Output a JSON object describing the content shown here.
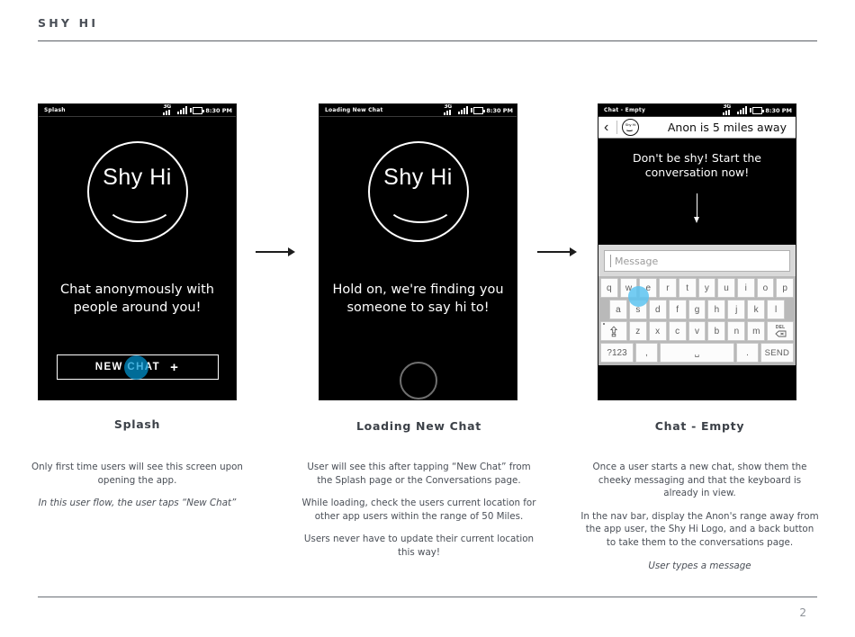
{
  "header": {
    "title": "SHY HI"
  },
  "footer": {
    "page_number": "2"
  },
  "status_bar": {
    "time": "8:30 PM",
    "network": "3G",
    "icons": [
      "3g-icon",
      "signal-bars-icon",
      "battery-icon"
    ]
  },
  "screens": [
    {
      "id": "splash",
      "status_label": "Splash",
      "logo_text": "Shy Hi",
      "headline": "Chat anonymously with people around you!",
      "button_label": "NEW CHAT",
      "button_plus": "+",
      "tap_indicator": "blue-tap-dot"
    },
    {
      "id": "loading-new-chat",
      "status_label": "Loading New Chat",
      "logo_text": "Shy Hi",
      "headline": "Hold on, we're finding you someone to say hi to!",
      "spinner": "loading-spinner"
    },
    {
      "id": "chat-empty",
      "status_label": "Chat - Empty",
      "nav": {
        "back_glyph": "‹",
        "logo_text": "Shy Hi",
        "title": "Anon is 5 miles away"
      },
      "cta": "Don't be shy! Start the conversation now!",
      "arrow": "down-arrow",
      "input": {
        "placeholder": "Message",
        "value": ""
      },
      "keyboard": {
        "row1": [
          "q",
          "w",
          "e",
          "r",
          "t",
          "y",
          "u",
          "i",
          "o",
          "p"
        ],
        "row2": [
          "a",
          "s",
          "d",
          "f",
          "g",
          "h",
          "j",
          "k",
          "l"
        ],
        "row3_shift": "shift",
        "row3": [
          "z",
          "x",
          "c",
          "v",
          "b",
          "n",
          "m"
        ],
        "row3_del": "DEL",
        "row4_symbols": "?123",
        "row4_comma": ",",
        "row4_space": "␣",
        "row4_period": ".",
        "row4_send": "SEND"
      },
      "tap_indicator": "blue-tap-dot"
    }
  ],
  "flow_arrows": [
    "arrow-right",
    "arrow-right"
  ],
  "captions": [
    {
      "title": "Splash",
      "paragraphs": [
        {
          "text": "Only first time users will see this screen upon opening the app.",
          "italic": false
        },
        {
          "text": "In this user flow, the user taps “New Chat”",
          "italic": true
        }
      ]
    },
    {
      "title": "Loading New Chat",
      "paragraphs": [
        {
          "text": "User will see this after tapping “New Chat” from the Splash page or the Conversations page.",
          "italic": false
        },
        {
          "text": "While loading, check the users current location for other app users within the range of 50 Miles.",
          "italic": false
        },
        {
          "text": "Users never have to update their current location this way!",
          "italic": false
        }
      ]
    },
    {
      "title": "Chat - Empty",
      "paragraphs": [
        {
          "text": "Once a user starts a new chat, show them the cheeky messaging and that the keyboard is already in view.",
          "italic": false
        },
        {
          "text": "In the nav bar, display the Anon's range away from the app user, the Shy Hi Logo, and a back button to take them to the conversations page.",
          "italic": false
        },
        {
          "text": "User types a message",
          "italic": true
        }
      ]
    }
  ],
  "colors": {
    "accent_blue": "#0096d2",
    "key_tap_blue": "#5cc3f0",
    "text_gray": "#4a4f57",
    "phone_black": "#000000"
  }
}
